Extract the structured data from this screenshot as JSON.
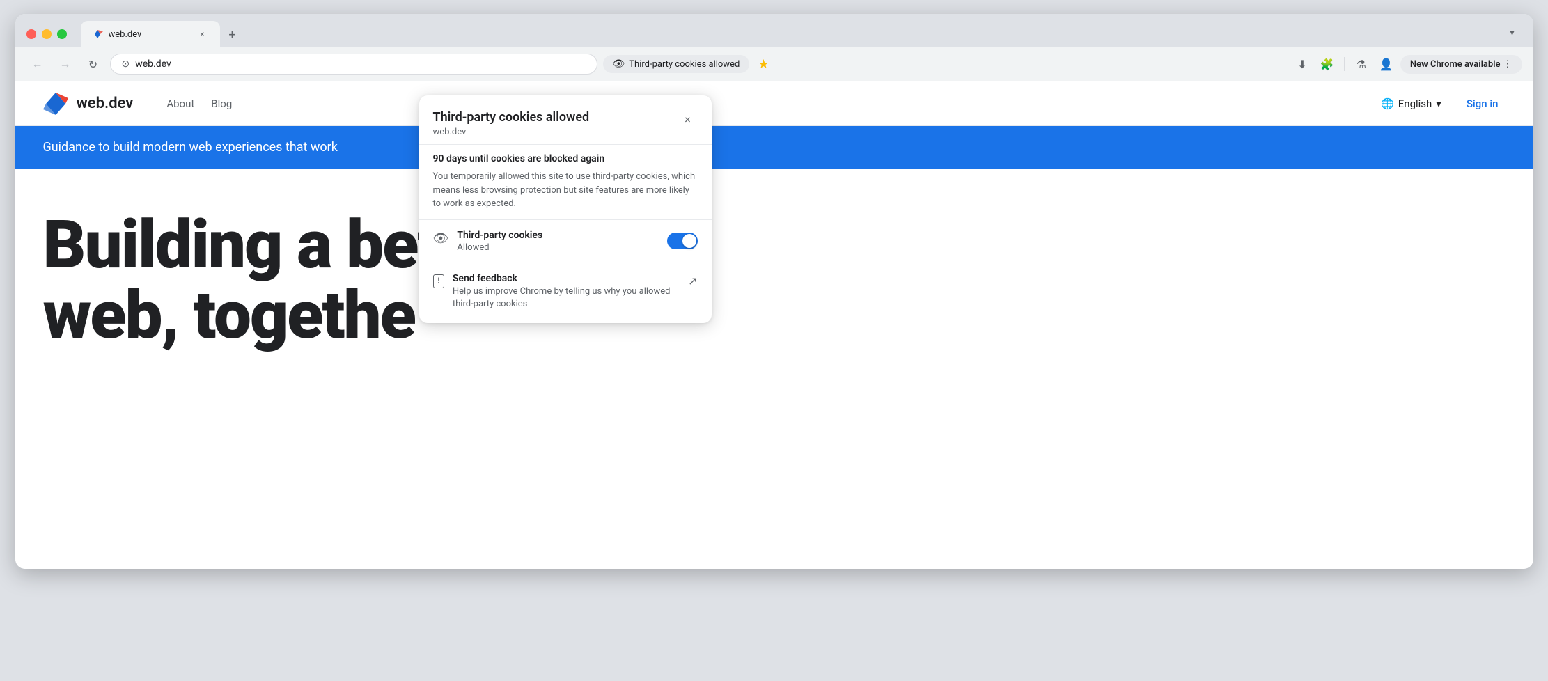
{
  "browser": {
    "tab": {
      "favicon_label": "web.dev favicon",
      "title": "web.dev",
      "close_label": "×",
      "new_tab_label": "+"
    },
    "tab_dropdown_label": "▾",
    "nav": {
      "back_label": "←",
      "forward_label": "→",
      "reload_label": "↻",
      "address_icon_label": "⊙",
      "address": "web.dev",
      "cookie_pill_label": "Third-party cookies allowed",
      "bookmark_label": "★",
      "download_label": "⬇",
      "extensions_label": "🧩",
      "labs_label": "⚗",
      "profile_label": "👤",
      "new_chrome_label": "New Chrome available",
      "more_label": "⋮"
    },
    "popup": {
      "title": "Third-party cookies allowed",
      "domain": "web.dev",
      "close_label": "×",
      "warning_title": "90 days until cookies are blocked again",
      "warning_text": "You temporarily allowed this site to use third-party cookies, which means less browsing protection but site features are more likely to work as expected.",
      "toggle_label": "Third-party cookies",
      "toggle_sublabel": "Allowed",
      "toggle_enabled": true,
      "feedback_title": "Send feedback",
      "feedback_subtitle": "Help us improve Chrome by telling us why you allowed third-party cookies",
      "external_icon_label": "↗"
    }
  },
  "website": {
    "logo_text": "web.dev",
    "nav": [
      {
        "label": "About"
      },
      {
        "label": "Blog"
      }
    ],
    "language_label": "English",
    "language_chevron": "▾",
    "signin_label": "Sign in",
    "banner_text": "Guidance to build modern web experiences that work",
    "hero_title_line1": "Building a bet",
    "hero_title_line2": "web, togethe"
  }
}
